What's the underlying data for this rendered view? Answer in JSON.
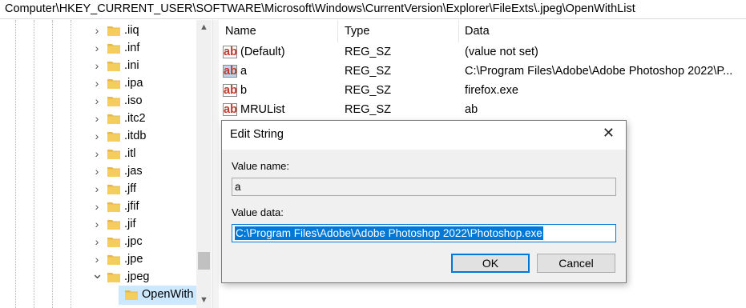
{
  "address_bar": "Computer\\HKEY_CURRENT_USER\\SOFTWARE\\Microsoft\\Windows\\CurrentVersion\\Explorer\\FileExts\\.jpeg\\OpenWithList",
  "tree": {
    "items": [
      {
        "label": ".iiq",
        "expanded": false
      },
      {
        "label": ".inf",
        "expanded": false
      },
      {
        "label": ".ini",
        "expanded": false
      },
      {
        "label": ".ipa",
        "expanded": false
      },
      {
        "label": ".iso",
        "expanded": false
      },
      {
        "label": ".itc2",
        "expanded": false
      },
      {
        "label": ".itdb",
        "expanded": false
      },
      {
        "label": ".itl",
        "expanded": false
      },
      {
        "label": ".jas",
        "expanded": false
      },
      {
        "label": ".jff",
        "expanded": false
      },
      {
        "label": ".jfif",
        "expanded": false
      },
      {
        "label": ".jif",
        "expanded": false
      },
      {
        "label": ".jpc",
        "expanded": false
      },
      {
        "label": ".jpe",
        "expanded": false
      },
      {
        "label": ".jpeg",
        "expanded": true
      }
    ],
    "selected_child": "OpenWith"
  },
  "list": {
    "columns": {
      "name": "Name",
      "type": "Type",
      "data": "Data"
    },
    "rows": [
      {
        "name": "(Default)",
        "type": "REG_SZ",
        "data": "(value not set)"
      },
      {
        "name": "a",
        "type": "REG_SZ",
        "data": "C:\\Program Files\\Adobe\\Adobe Photoshop 2022\\P..."
      },
      {
        "name": "b",
        "type": "REG_SZ",
        "data": "firefox.exe"
      },
      {
        "name": "MRUList",
        "type": "REG_SZ",
        "data": "ab"
      }
    ],
    "icon_text": "ab"
  },
  "dialog": {
    "title": "Edit String",
    "close": "✕",
    "value_name_label": "Value name:",
    "value_name": "a",
    "value_data_label": "Value data:",
    "value_data": "C:\\Program Files\\Adobe\\Adobe Photoshop 2022\\Photoshop.exe",
    "ok": "OK",
    "cancel": "Cancel"
  },
  "icons": [
    "chevron-right-icon",
    "chevron-down-icon",
    "folder-icon",
    "registry-string-icon",
    "close-icon"
  ],
  "colors": {
    "selection": "#cce8ff",
    "accent": "#0078d7",
    "folder": "#e8b84a"
  }
}
